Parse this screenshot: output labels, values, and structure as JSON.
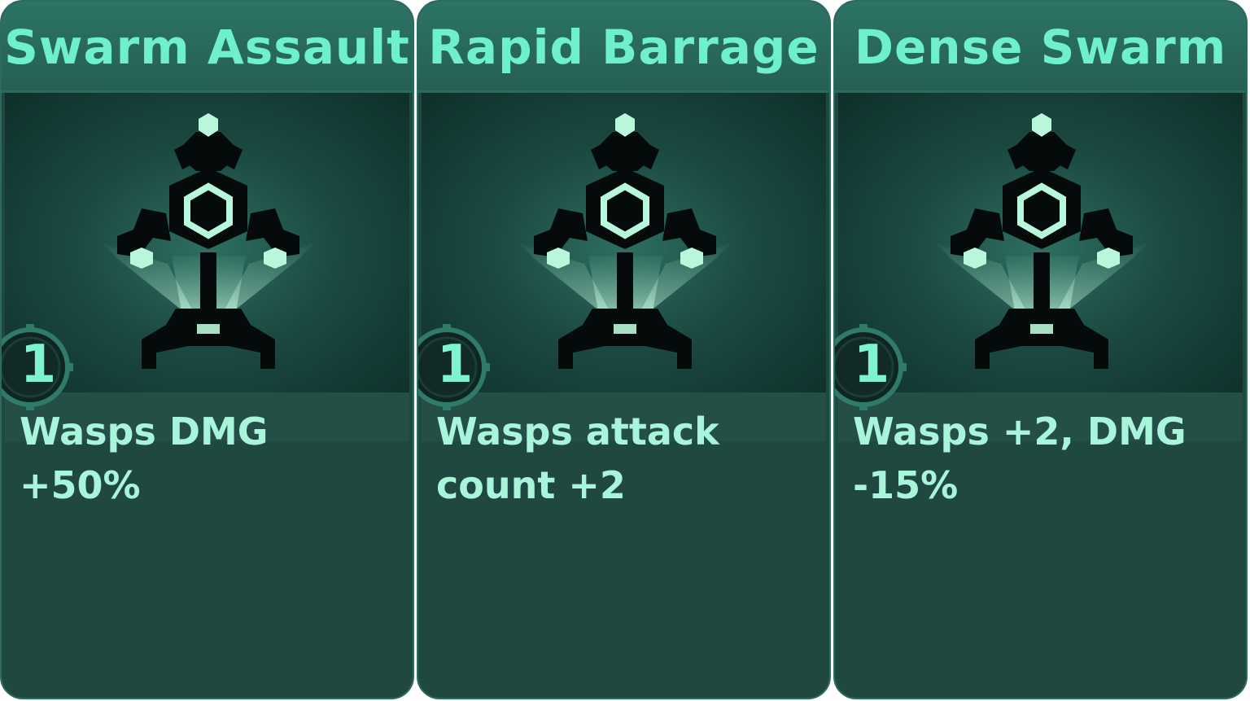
{
  "cards": [
    {
      "title": "Swarm Assault",
      "level": "1",
      "description": "Wasps DMG +50%"
    },
    {
      "title": "Rapid Barrage",
      "level": "1",
      "description": "Wasps attack count +2"
    },
    {
      "title": "Dense Swarm",
      "level": "1",
      "description": "Wasps +2, DMG -15%"
    }
  ],
  "icons": [
    "wasp-drone-icon"
  ],
  "colors": {
    "card_bg": "#1f4840",
    "header_bg": "#2c7465",
    "title_text": "#6ef0cf",
    "desc_text": "#a8f5dc",
    "glow": "#b9f7dc"
  }
}
